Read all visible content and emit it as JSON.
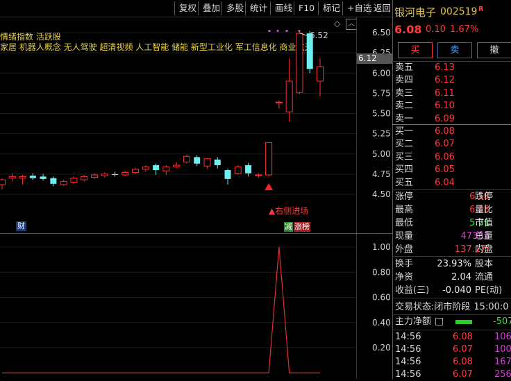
{
  "toolbar": [
    "复权",
    "叠加",
    "多股",
    "统计",
    "画线",
    "F10",
    "标记",
    "+自选",
    "返回"
  ],
  "concepts": {
    "line1": "情绪指数  活跃股",
    "line2": "家居  机器人概念  无人驾驶  超清视频  人工智能  储能  新型工业化  军工信息化  商业航天"
  },
  "chart": {
    "max_label": "6.52",
    "signal_label": "▲右侧进场",
    "fin_badge": "财",
    "tag_green": "减",
    "tag_red": "涨榜",
    "current_price_tag": "6.12"
  },
  "chart_data": [
    {
      "type": "candlestick",
      "y_ticks": [
        "6.50",
        "6.25",
        "6.00",
        "5.75",
        "5.50",
        "5.25",
        "5.00",
        "4.75",
        "4.50"
      ],
      "ylim": [
        4.4,
        6.6
      ],
      "candles": [
        {
          "o": 4.62,
          "h": 4.7,
          "l": 4.56,
          "c": 4.68
        },
        {
          "o": 4.7,
          "h": 4.76,
          "l": 4.66,
          "c": 4.72
        },
        {
          "o": 4.7,
          "h": 4.74,
          "l": 4.62,
          "c": 4.72
        },
        {
          "o": 4.73,
          "h": 4.76,
          "l": 4.68,
          "c": 4.7
        },
        {
          "o": 4.72,
          "h": 4.75,
          "l": 4.67,
          "c": 4.69
        },
        {
          "o": 4.7,
          "h": 4.72,
          "l": 4.6,
          "c": 4.63
        },
        {
          "o": 4.62,
          "h": 4.68,
          "l": 4.6,
          "c": 4.66
        },
        {
          "o": 4.65,
          "h": 4.72,
          "l": 4.63,
          "c": 4.7
        },
        {
          "o": 4.68,
          "h": 4.74,
          "l": 4.66,
          "c": 4.72
        },
        {
          "o": 4.71,
          "h": 4.76,
          "l": 4.69,
          "c": 4.74
        },
        {
          "o": 4.73,
          "h": 4.77,
          "l": 4.71,
          "c": 4.75
        },
        {
          "o": 4.75,
          "h": 4.78,
          "l": 4.72,
          "c": 4.74
        },
        {
          "o": 4.74,
          "h": 4.79,
          "l": 4.72,
          "c": 4.77
        },
        {
          "o": 4.77,
          "h": 4.83,
          "l": 4.75,
          "c": 4.81
        },
        {
          "o": 4.81,
          "h": 4.86,
          "l": 4.78,
          "c": 4.84
        },
        {
          "o": 4.86,
          "h": 4.88,
          "l": 4.74,
          "c": 4.8
        },
        {
          "o": 4.79,
          "h": 4.86,
          "l": 4.74,
          "c": 4.84
        },
        {
          "o": 4.84,
          "h": 4.9,
          "l": 4.82,
          "c": 4.86
        },
        {
          "o": 4.9,
          "h": 4.99,
          "l": 4.88,
          "c": 4.97
        },
        {
          "o": 4.96,
          "h": 4.98,
          "l": 4.85,
          "c": 4.88
        },
        {
          "o": 4.85,
          "h": 4.95,
          "l": 4.82,
          "c": 4.94
        },
        {
          "o": 4.93,
          "h": 4.96,
          "l": 4.82,
          "c": 4.86
        },
        {
          "o": 4.8,
          "h": 4.82,
          "l": 4.62,
          "c": 4.69
        },
        {
          "o": 4.76,
          "h": 4.86,
          "l": 4.74,
          "c": 4.84
        },
        {
          "o": 4.86,
          "h": 4.89,
          "l": 4.72,
          "c": 4.76
        },
        {
          "o": 4.74,
          "h": 4.76,
          "l": 4.7,
          "c": 4.74
        },
        {
          "o": 4.74,
          "h": 5.14,
          "l": 4.72,
          "c": 5.14
        },
        {
          "o": 5.64,
          "h": 5.66,
          "l": 5.56,
          "c": 5.64
        },
        {
          "o": 5.52,
          "h": 6.18,
          "l": 5.4,
          "c": 5.9
        },
        {
          "o": 5.76,
          "h": 6.52,
          "l": 5.74,
          "c": 6.49
        },
        {
          "o": 6.49,
          "h": 6.52,
          "l": 6.0,
          "c": 6.05
        },
        {
          "o": 5.9,
          "h": 6.18,
          "l": 5.71,
          "c": 6.08
        }
      ]
    },
    {
      "type": "line",
      "y_ticks": [
        "1.00",
        "0.80",
        "0.60",
        "0.40",
        "0.20"
      ],
      "ylim": [
        0,
        1.1
      ],
      "values": [
        0,
        0,
        0,
        0,
        0,
        0,
        0,
        0,
        0,
        0,
        0,
        0,
        0,
        0,
        0,
        0,
        0,
        0,
        0,
        0,
        0,
        0,
        0,
        0,
        0,
        0,
        0,
        1,
        0,
        0,
        0,
        0
      ]
    }
  ],
  "quote": {
    "name": "银河电子",
    "code": "002519",
    "r": "R",
    "price": "6.08",
    "change": "0.10",
    "pct": "1.67%"
  },
  "actions": [
    "买",
    "卖",
    "撤"
  ],
  "sell": [
    {
      "label": "卖五",
      "price": "6.13"
    },
    {
      "label": "卖四",
      "price": "6.12"
    },
    {
      "label": "卖三",
      "price": "6.11"
    },
    {
      "label": "卖二",
      "price": "6.10"
    },
    {
      "label": "卖一",
      "price": "6.09"
    }
  ],
  "buy": [
    {
      "label": "买一",
      "price": "6.08"
    },
    {
      "label": "买二",
      "price": "6.07"
    },
    {
      "label": "买三",
      "price": "6.06"
    },
    {
      "label": "买四",
      "price": "6.05"
    },
    {
      "label": "买五",
      "price": "6.04"
    }
  ],
  "stats": [
    {
      "l": "涨停",
      "v": "6.58",
      "r": "跌停",
      "c": "red"
    },
    {
      "l": "最高",
      "v": "6.18",
      "r": "量比",
      "c": "red"
    },
    {
      "l": "最低",
      "v": "5.71",
      "r": "市值",
      "c": "green"
    },
    {
      "l": "现量",
      "v": "47352",
      "r": "总量",
      "c": "mag"
    },
    {
      "l": "外盘",
      "v": "137.1万",
      "r": "内盘",
      "c": "red"
    }
  ],
  "stats2": [
    {
      "l": "换手",
      "v": "23.93%",
      "r": "股本"
    },
    {
      "l": "净资",
      "v": "2.04",
      "r": "流通"
    },
    {
      "l": "收益(三)",
      "v": "-0.040",
      "r": "PE(动)"
    }
  ],
  "trade_status": {
    "label": "交易状态:",
    "value": "闭市阶段",
    "time": "15:00:0"
  },
  "net_inflow": {
    "label": "主力净额",
    "value": "-507"
  },
  "ticks": [
    {
      "t": "14:56",
      "p": "6.08",
      "v": "106"
    },
    {
      "t": "14:56",
      "p": "6.07",
      "v": "100"
    },
    {
      "t": "14:56",
      "p": "6.08",
      "v": "167"
    },
    {
      "t": "14:56",
      "p": "6.07",
      "v": "256"
    }
  ]
}
